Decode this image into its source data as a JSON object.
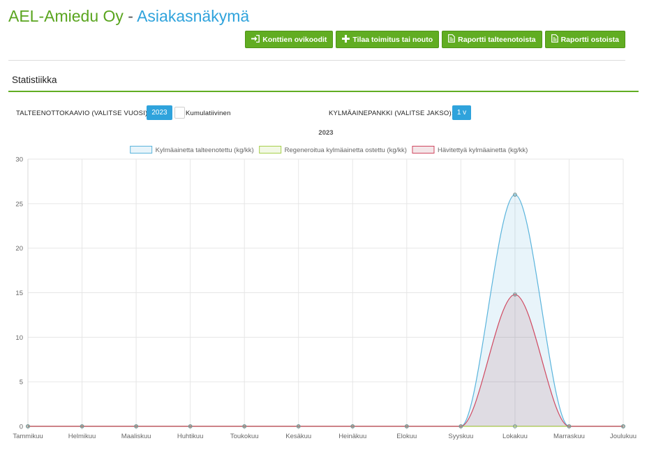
{
  "header": {
    "company": "AEL-Amiedu Oy",
    "separator": "-",
    "view": "Asiakasnäkymä"
  },
  "toolbar": {
    "buttons": [
      {
        "label": "Konttien ovikoodit",
        "icon": "sign-in-icon"
      },
      {
        "label": "Tilaa toimitus tai nouto",
        "icon": "plus-icon"
      },
      {
        "label": "Raportti talteenotoista",
        "icon": "document-icon"
      },
      {
        "label": "Raportti ostoista",
        "icon": "document-icon"
      }
    ]
  },
  "section": {
    "title": "Statistiikka"
  },
  "controls": {
    "chart_label": "TALTEENOTTOKAAVIO (VALITSE VUOSI):",
    "year": "2023",
    "cumulative_label": "Kumulatiivinen",
    "bank_label": "KYLMÄAINEPANKKI (VALITSE JAKSO):",
    "period": "1 v"
  },
  "chart_data": {
    "type": "area",
    "title": "2023",
    "xlabel": "",
    "ylabel": "",
    "categories": [
      "Tammikuu",
      "Helmikuu",
      "Maaliskuu",
      "Huhtikuu",
      "Toukokuu",
      "Kesäkuu",
      "Heinäkuu",
      "Elokuu",
      "Syyskuu",
      "Lokakuu",
      "Marraskuu",
      "Joulukuu"
    ],
    "ylim": [
      0,
      30
    ],
    "yticks": [
      0,
      5,
      10,
      15,
      20,
      25,
      30
    ],
    "grid": true,
    "legend": "top",
    "series": [
      {
        "name": "Kylmäainetta talteenotettu (kg/kk)",
        "values": [
          0,
          0,
          0,
          0,
          0,
          0,
          0,
          0,
          0,
          26,
          0,
          0
        ],
        "color": "#5ab4dc",
        "fill": "rgba(90,180,220,0.14)"
      },
      {
        "name": "Regeneroitua kylmäainetta ostettu (kg/kk)",
        "values": [
          0,
          0,
          0,
          0,
          0,
          0,
          0,
          0,
          0,
          0,
          0,
          0
        ],
        "color": "#a6cf4a",
        "fill": "rgba(166,207,74,0.14)"
      },
      {
        "name": "Hävitettyä kylmäainetta (kg/kk)",
        "values": [
          0,
          0,
          0,
          0,
          0,
          0,
          0,
          0,
          0,
          14.8,
          0,
          0
        ],
        "color": "#d0475f",
        "fill": "rgba(160,60,80,0.13)"
      }
    ]
  }
}
